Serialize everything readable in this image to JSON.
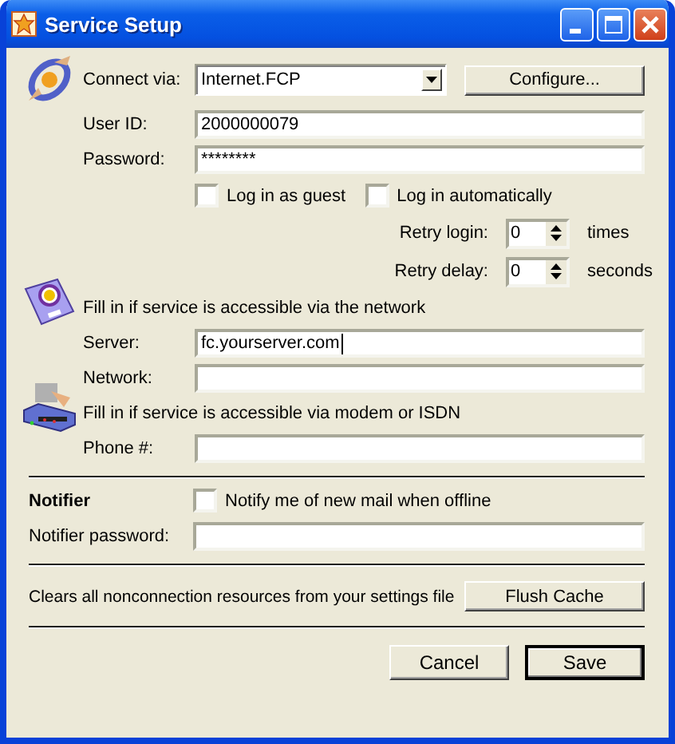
{
  "window": {
    "title": "Service Setup"
  },
  "connection": {
    "connect_via": {
      "label": "Connect via:",
      "value": "Internet.FCP"
    },
    "configure_button": "Configure...",
    "user_id": {
      "label": "User ID:",
      "value": "2000000079"
    },
    "password": {
      "label": "Password:",
      "value": "********"
    },
    "options": [
      {
        "label": "Log in as guest",
        "checked": false
      },
      {
        "label": "Log in automatically",
        "checked": false
      }
    ],
    "retries": [
      {
        "label": "Retry login:",
        "value": "0",
        "unit": "times"
      },
      {
        "label": "Retry delay:",
        "value": "0",
        "unit": "seconds"
      }
    ]
  },
  "network": {
    "hint": "Fill in if service is accessible via the network",
    "fields": [
      {
        "label": "Server:",
        "value": "fc.yourserver.com",
        "focused": true
      },
      {
        "label": "Network:",
        "focused": false
      }
    ]
  },
  "modem": {
    "hint": "Fill in if service is accessible via modem or ISDN",
    "fields": [
      {
        "label": "Phone #:",
        "focused": false
      }
    ]
  },
  "notifier": {
    "heading": "Notifier",
    "option": {
      "label": "Notify me of new mail when offline",
      "checked": false
    },
    "password": {
      "label": "Notifier password:"
    }
  },
  "cache": {
    "description": "Clears all nonconnection resources from your settings file",
    "button": "Flush Cache"
  },
  "buttons": [
    {
      "label": "Cancel",
      "default": false
    },
    {
      "label": "Save",
      "default": true
    }
  ]
}
